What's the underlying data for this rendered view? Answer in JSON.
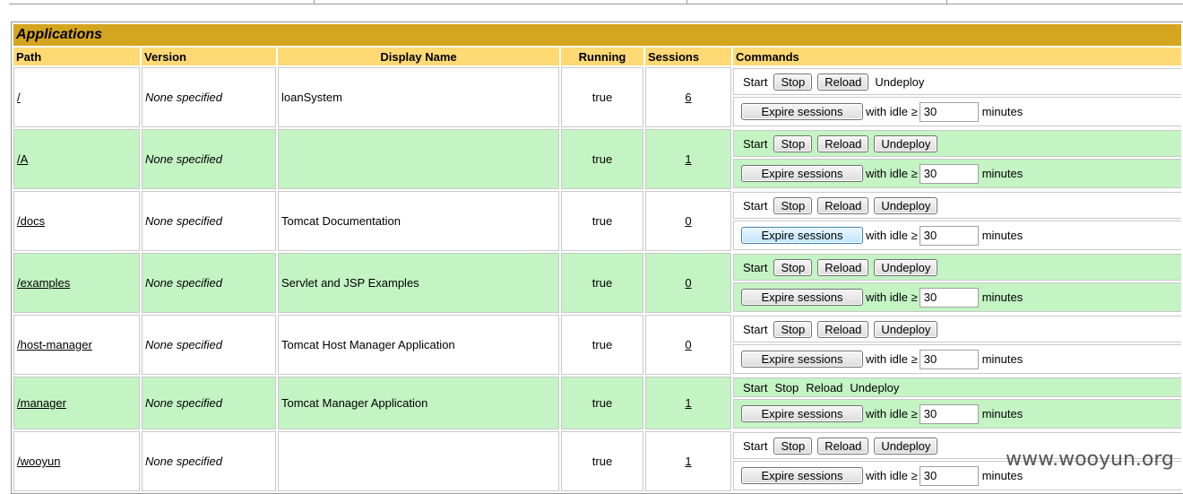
{
  "table": {
    "title": "Applications",
    "headers": {
      "path": "Path",
      "version": "Version",
      "display_name": "Display Name",
      "running": "Running",
      "sessions": "Sessions",
      "commands": "Commands"
    },
    "rows": [
      {
        "path": "/",
        "version": "None specified",
        "display_name": "loanSystem",
        "running": "true",
        "sessions": "6"
      },
      {
        "path": "/A",
        "version": "None specified",
        "display_name": "",
        "running": "true",
        "sessions": "1"
      },
      {
        "path": "/docs",
        "version": "None specified",
        "display_name": "Tomcat Documentation",
        "running": "true",
        "sessions": "0"
      },
      {
        "path": "/examples",
        "version": "None specified",
        "display_name": "Servlet and JSP Examples",
        "running": "true",
        "sessions": "0"
      },
      {
        "path": "/host-manager",
        "version": "None specified",
        "display_name": "Tomcat Host Manager Application",
        "running": "true",
        "sessions": "0"
      },
      {
        "path": "/manager",
        "version": "None specified",
        "display_name": "Tomcat Manager Application",
        "running": "true",
        "sessions": "1"
      },
      {
        "path": "/wooyun",
        "version": "None specified",
        "display_name": "",
        "running": "true",
        "sessions": "1"
      }
    ]
  },
  "commands": {
    "start": "Start",
    "stop": "Stop",
    "reload": "Reload",
    "undeploy": "Undeploy",
    "expire_sessions": "Expire sessions",
    "with_idle": "with idle ≥",
    "idle_value": "30",
    "minutes": "minutes"
  },
  "watermark": "www.wooyun.org"
}
